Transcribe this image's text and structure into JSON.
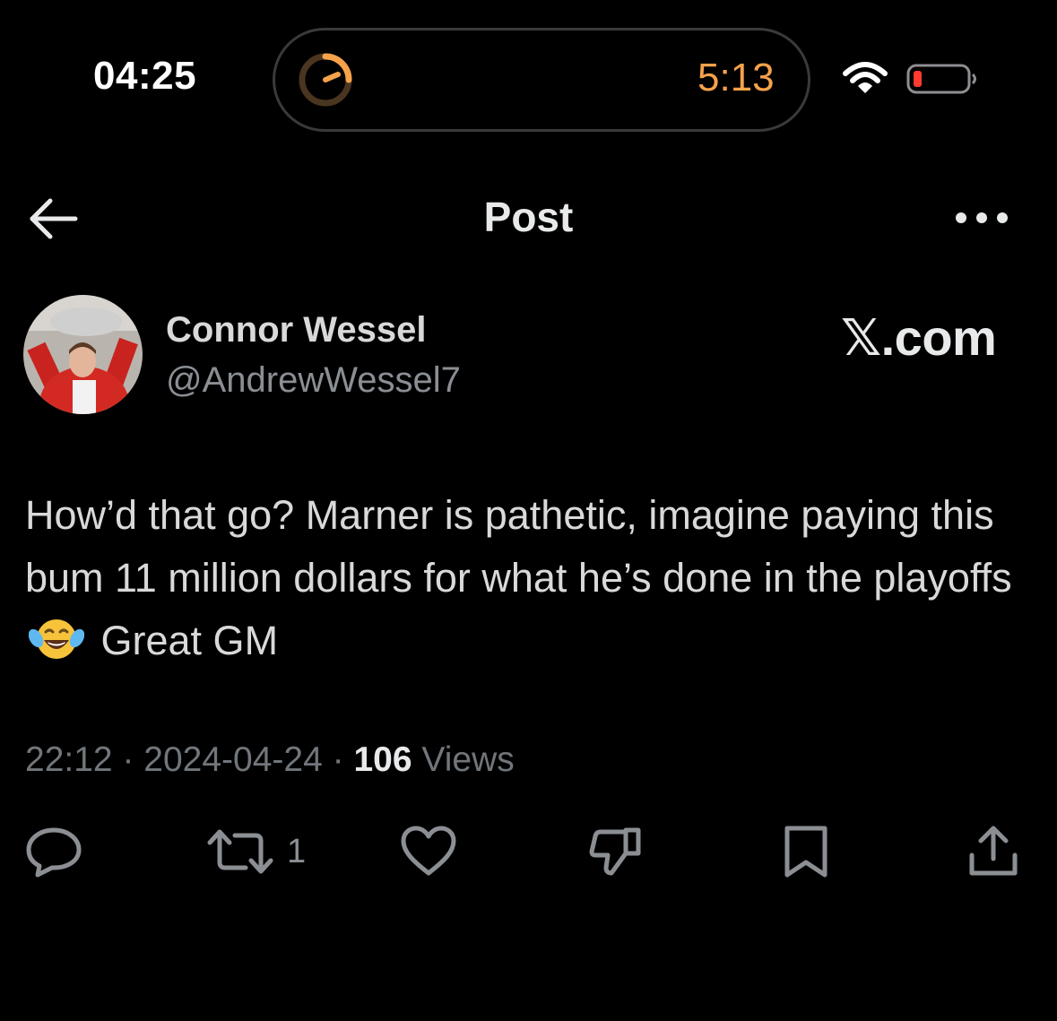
{
  "status_bar": {
    "clock": "04:25",
    "live_activity_timer": "5:13",
    "icons": [
      "timer-icon",
      "wifi-icon",
      "battery-icon"
    ],
    "accent_color": "#f5a24b",
    "battery_color": "#ff3b30"
  },
  "nav": {
    "title": "Post",
    "icons": [
      "back-arrow-icon",
      "more-icon"
    ]
  },
  "post": {
    "author_name": "Connor Wessel",
    "author_handle": "@AndrewWessel7",
    "brand": "𝕏.com",
    "text_before_emoji": "How’d that go? Marner is pathetic, imagine paying this bum 11 million dollars for what he’s done in the playoffs",
    "emoji": "face-with-tears-of-joy",
    "text_after_emoji": "Great GM",
    "time": "22:12",
    "date": "2024-04-24",
    "separator": "·",
    "views_count": "106",
    "views_label": "Views"
  },
  "actions": {
    "reply_icon": "reply-icon",
    "repost_icon": "repost-icon",
    "repost_count": "1",
    "like_icon": "heart-icon",
    "dislike_icon": "thumbs-down-icon",
    "bookmark_icon": "bookmark-icon",
    "share_icon": "share-icon"
  }
}
